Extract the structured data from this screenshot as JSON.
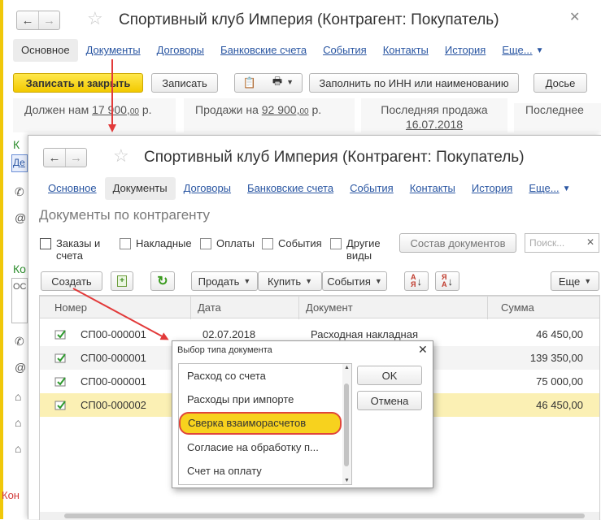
{
  "back_window": {
    "title": "Спортивный клуб Империя (Контрагент: Покупатель)",
    "tabs": [
      "Основное",
      "Документы",
      "Договоры",
      "Банковские счета",
      "События",
      "Контакты",
      "История",
      "Еще..."
    ],
    "buttons": {
      "save_close": "Записать и закрыть",
      "save": "Записать",
      "fill_inn": "Заполнить по ИНН или наименованию",
      "dossier": "Досье"
    },
    "info": {
      "debt_label": "Должен нам",
      "debt_value": "17 900,",
      "debt_kop": "00",
      "debt_unit": "р.",
      "sales_label": "Продажи на",
      "sales_value": "92 900,",
      "sales_kop": "00",
      "sales_unit": "р.",
      "last_sale_label": "Последняя продажа",
      "last_sale_date": "16.07.2018",
      "last_cut": "Последнее"
    },
    "side": {
      "green1": "К",
      "green2": "Ко",
      "bottom": "Кон",
      "field_box": "Де",
      "field_box2": "ОС"
    }
  },
  "front_window": {
    "title": "Спортивный клуб Империя (Контрагент: Покупатель)",
    "tabs": [
      "Основное",
      "Документы",
      "Договоры",
      "Банковские счета",
      "События",
      "Контакты",
      "История",
      "Еще..."
    ],
    "section_title": "Документы по контрагенту",
    "filters": [
      {
        "label": "Заказы и",
        "label2": "счета"
      },
      {
        "label": "Накладные"
      },
      {
        "label": "Оплаты"
      },
      {
        "label": "События"
      },
      {
        "label": "Другие",
        "label2": "виды"
      }
    ],
    "compose_button": "Состав документов",
    "search_placeholder": "Поиск...",
    "toolbar": {
      "create": "Создать",
      "sell": "Продать",
      "buy": "Купить",
      "events": "События",
      "more": "Еще"
    },
    "columns": [
      "Номер",
      "Дата",
      "Документ",
      "Сумма"
    ],
    "rows": [
      {
        "number": "СП00-000001",
        "date": "02.07.2018",
        "doc": "Расходная накладная",
        "sum": "46 450,00"
      },
      {
        "number": "СП00-000001",
        "date": "",
        "doc": "",
        "sum": "139 350,00"
      },
      {
        "number": "СП00-000001",
        "date": "",
        "doc": "",
        "sum": "75 000,00"
      },
      {
        "number": "СП00-000002",
        "date": "",
        "doc": "",
        "sum": "46 450,00"
      }
    ]
  },
  "dialog": {
    "title": "Выбор типа документа",
    "items": [
      "Расход со счета",
      "Расходы при импорте",
      "Сверка взаиморасчетов",
      "Согласие на обработку п...",
      "Счет на оплату"
    ],
    "ok": "OK",
    "cancel": "Отмена"
  },
  "colors": {
    "accent_yellow": "#f7d21e",
    "link_blue": "#2a56a2",
    "arrow_red": "#e23a3a",
    "selected_row": "#fbf0b4"
  }
}
